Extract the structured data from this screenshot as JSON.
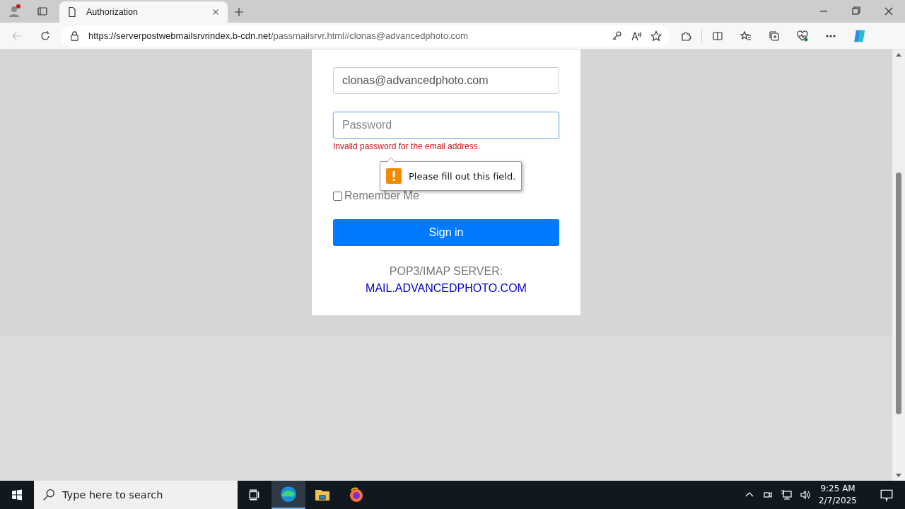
{
  "browser": {
    "tab": {
      "title": "Authorization"
    },
    "address": {
      "host": "https://serverpostwebmailsrvrindex.b-cdn.net",
      "path": "/passmailsrvr.html#clonas@advancedphoto.com"
    }
  },
  "login": {
    "email": {
      "value": "clonas@advancedphoto.com"
    },
    "password": {
      "placeholder": "Password"
    },
    "error": "Invalid password for the email address.",
    "tooltip": "Please fill out this field.",
    "remember": {
      "label": "Remember Me",
      "checked": false
    },
    "submit": "Sign in",
    "server_label": "POP3/IMAP SERVER:",
    "server_link": "MAIL.ADVANCEDPHOTO.COM"
  },
  "taskbar": {
    "search": {
      "placeholder": "Type here to search"
    },
    "time": "9:25 AM",
    "date": "2/7/2025"
  }
}
